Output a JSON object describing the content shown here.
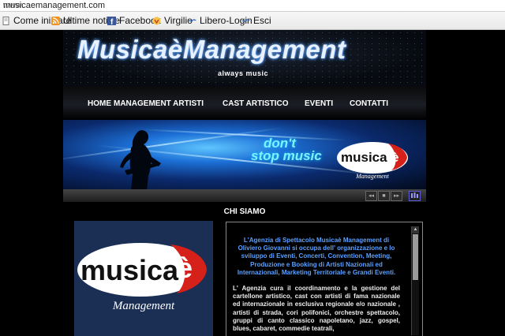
{
  "browser": {
    "url_prefix": "www.",
    "url_domain": "musicaemanagement.com",
    "bookmarks": [
      {
        "label": "Come iniziare",
        "icon": "page-icon"
      },
      {
        "label": "Ultime notizie",
        "icon": "rss-icon"
      },
      {
        "label": "Facebook",
        "icon": "facebook-icon"
      },
      {
        "label": "Virgilio",
        "icon": "virgilio-icon"
      },
      {
        "label": "Libero-Login",
        "icon": "libero-icon"
      },
      {
        "label": "Esci",
        "icon": "libero-icon"
      }
    ]
  },
  "header": {
    "logo": "MusicaèManagement",
    "tagline": "always music"
  },
  "nav": {
    "items": [
      "HOME",
      "MANAGEMENT ARTISTI",
      "CAST ARTISTICO",
      "EVENTI",
      "CONTATTI"
    ]
  },
  "banner": {
    "slogan_line1": "don't",
    "slogan_line2": "stop music",
    "logo_word": "musica",
    "logo_accent": "è",
    "logo_sub": "Management"
  },
  "slider_controls": [
    "◂◂",
    "■",
    "▸▸"
  ],
  "section": {
    "title": "CHI SIAMO"
  },
  "logo_box": {
    "word": "musica",
    "accent": "è",
    "sub": "Management"
  },
  "about": {
    "intro": "L'Agenzia di Spettacolo Musicaè Management di Oliviero Giovanni si occupa dell' organizzazione e lo sviluppo di Eventi, Concerti, Convention, Meeting, Produzione e Booking di Artisti Nazionali ed Internazionali, Marketing Territoriale e Grandi Eventi.",
    "body": "L' Agenzia cura il coordinamento e la gestione del cartellone artistico, cast con artisti di fama nazionale ed internazionale in esclusiva regionale e/o nazionale , artisti di strada, cori polifonici, orchestre spettacolo, gruppi di canto classico napoletano, jazz, gospel, blues, cabaret, commedie teatrali,"
  },
  "colors": {
    "logo_red": "#d6201a",
    "about_blue": "#5aa0ff",
    "banner_cyan": "#7df2ff"
  }
}
